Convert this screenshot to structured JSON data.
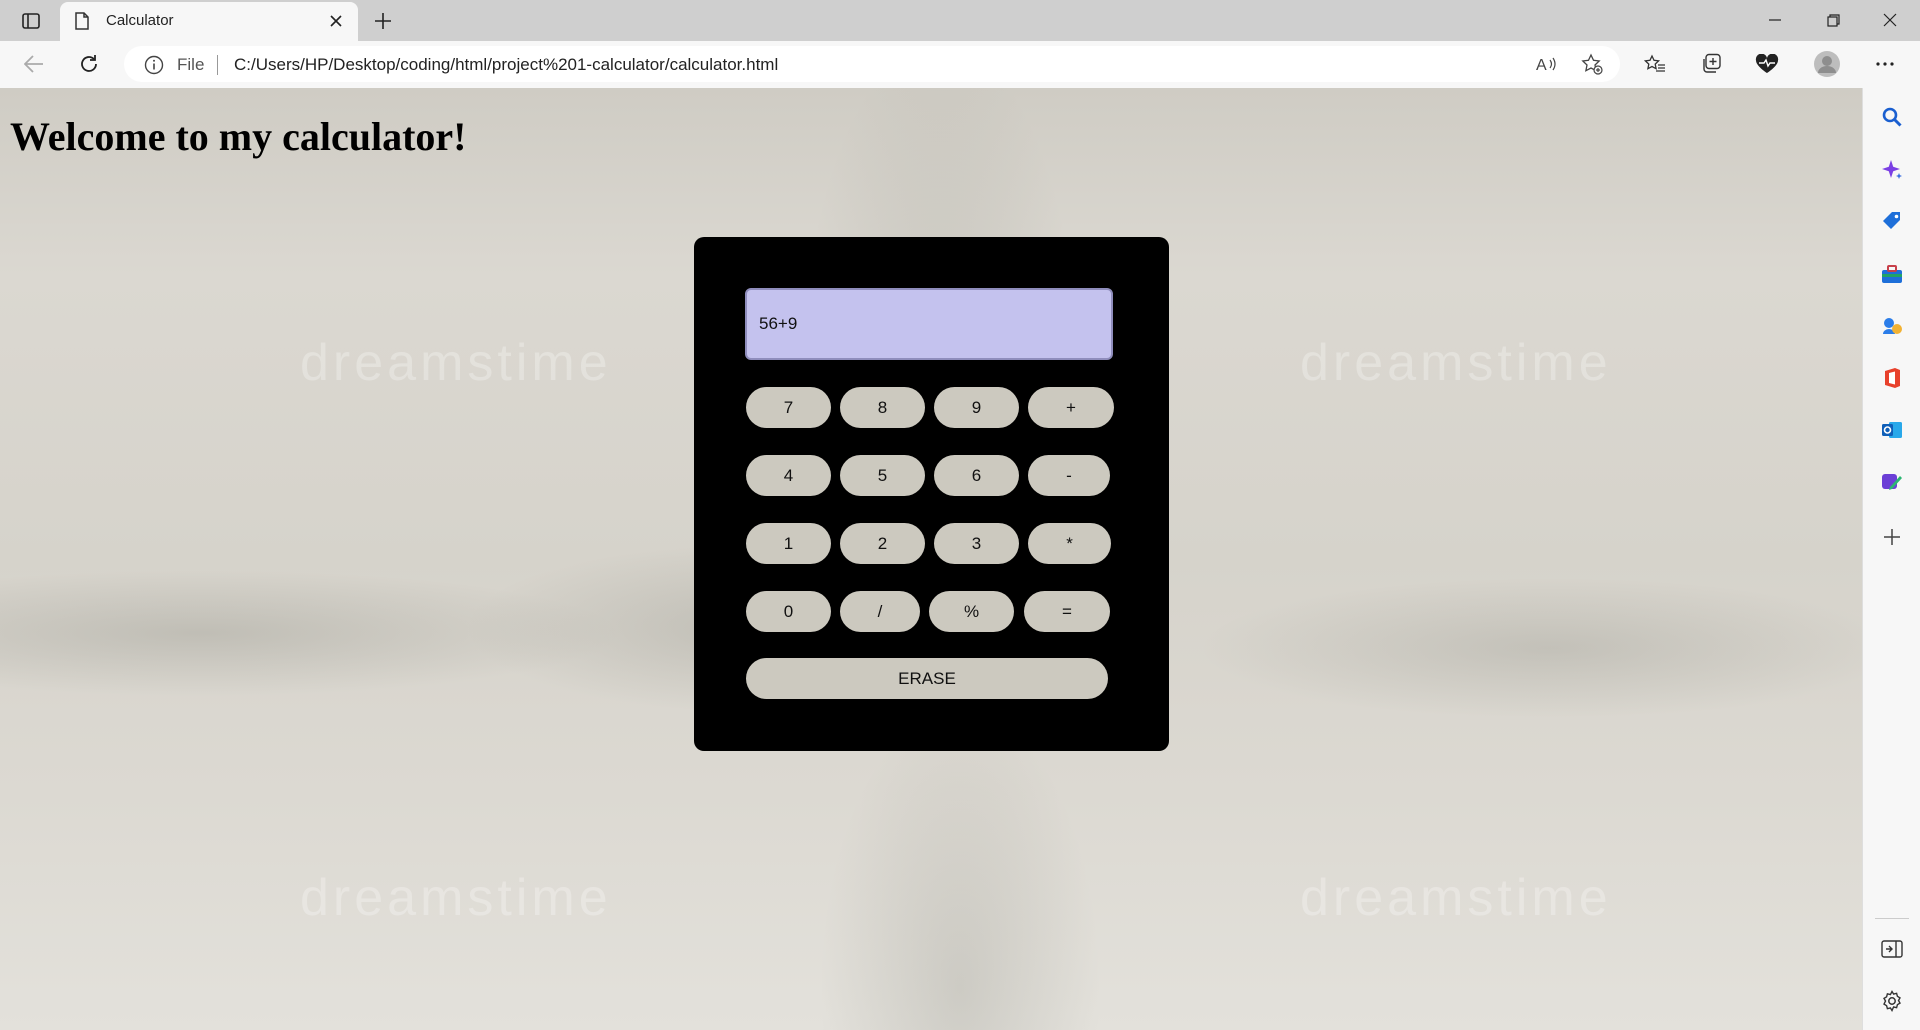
{
  "browser": {
    "tab": {
      "title": "Calculator"
    },
    "address": {
      "scheme_label": "File",
      "url": "C:/Users/HP/Desktop/coding/html/project%201-calculator/calculator.html"
    }
  },
  "page": {
    "heading": "Welcome to my calculator!",
    "watermark": "dreamstime"
  },
  "calculator": {
    "display_value": "56+9",
    "keys": {
      "seven": "7",
      "eight": "8",
      "nine": "9",
      "plus": "+",
      "four": "4",
      "five": "5",
      "six": "6",
      "minus": "-",
      "one": "1",
      "two": "2",
      "three": "3",
      "multiply": "*",
      "zero": "0",
      "divide": "/",
      "percent": "%",
      "equals": "="
    },
    "erase_label": "ERASE"
  },
  "colors": {
    "calculator_body": "#000000",
    "display_background": "#c4c2ee",
    "key_background": "#ccc9bf"
  },
  "icons": {
    "sidebar": [
      "search-icon",
      "copilot-icon",
      "shopping-tag-icon",
      "tools-icon",
      "games-icon",
      "office-icon",
      "outlook-icon",
      "designer-icon",
      "add-icon",
      "hide-sidebar-icon",
      "settings-icon"
    ]
  }
}
